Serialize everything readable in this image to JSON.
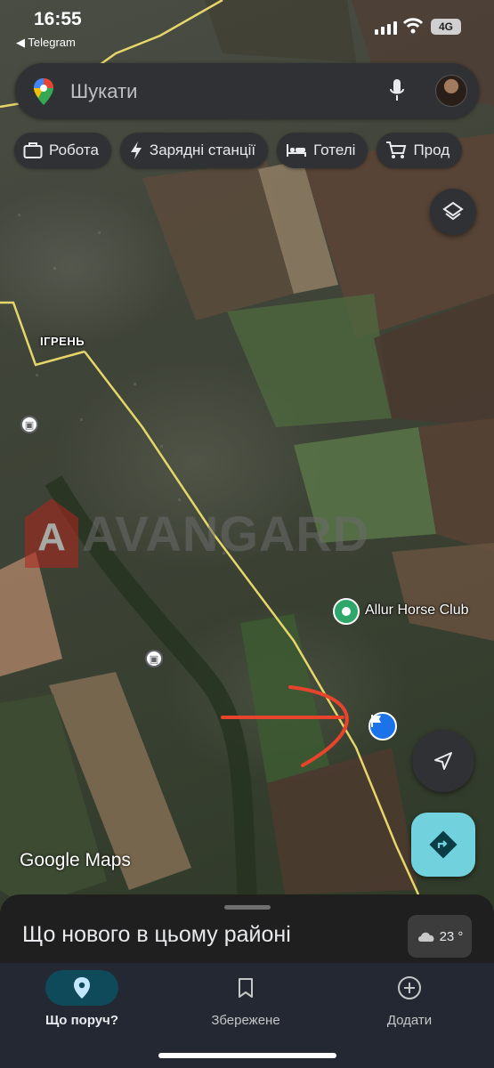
{
  "status_bar": {
    "time": "16:55",
    "back_app": "◀ Telegram",
    "network": "4G"
  },
  "search": {
    "placeholder": "Шукати",
    "pin_icon": "maps-pin-icon",
    "mic_icon": "mic-icon"
  },
  "chips": [
    {
      "label": "Робота",
      "icon": "briefcase-icon"
    },
    {
      "label": "Зарядні станції",
      "icon": "bolt-icon"
    },
    {
      "label": "Готелі",
      "icon": "bed-icon"
    },
    {
      "label": "Прод",
      "icon": "cart-icon"
    }
  ],
  "map": {
    "place_label": "ІГРЕНЬ",
    "poi_label": "Allur Horse Club",
    "watermark": "AVANGARD",
    "attribution": "Google Maps",
    "accent_colors": {
      "poi": "#2da86a",
      "flag": "#1a73e8",
      "annotation": "#e8442c",
      "road": "#e6d66a"
    }
  },
  "sheet": {
    "title": "Що нового в цьому районі",
    "weather": "23 °"
  },
  "nav": {
    "nearby": "Що поруч?",
    "saved": "Збережене",
    "add": "Додати"
  }
}
